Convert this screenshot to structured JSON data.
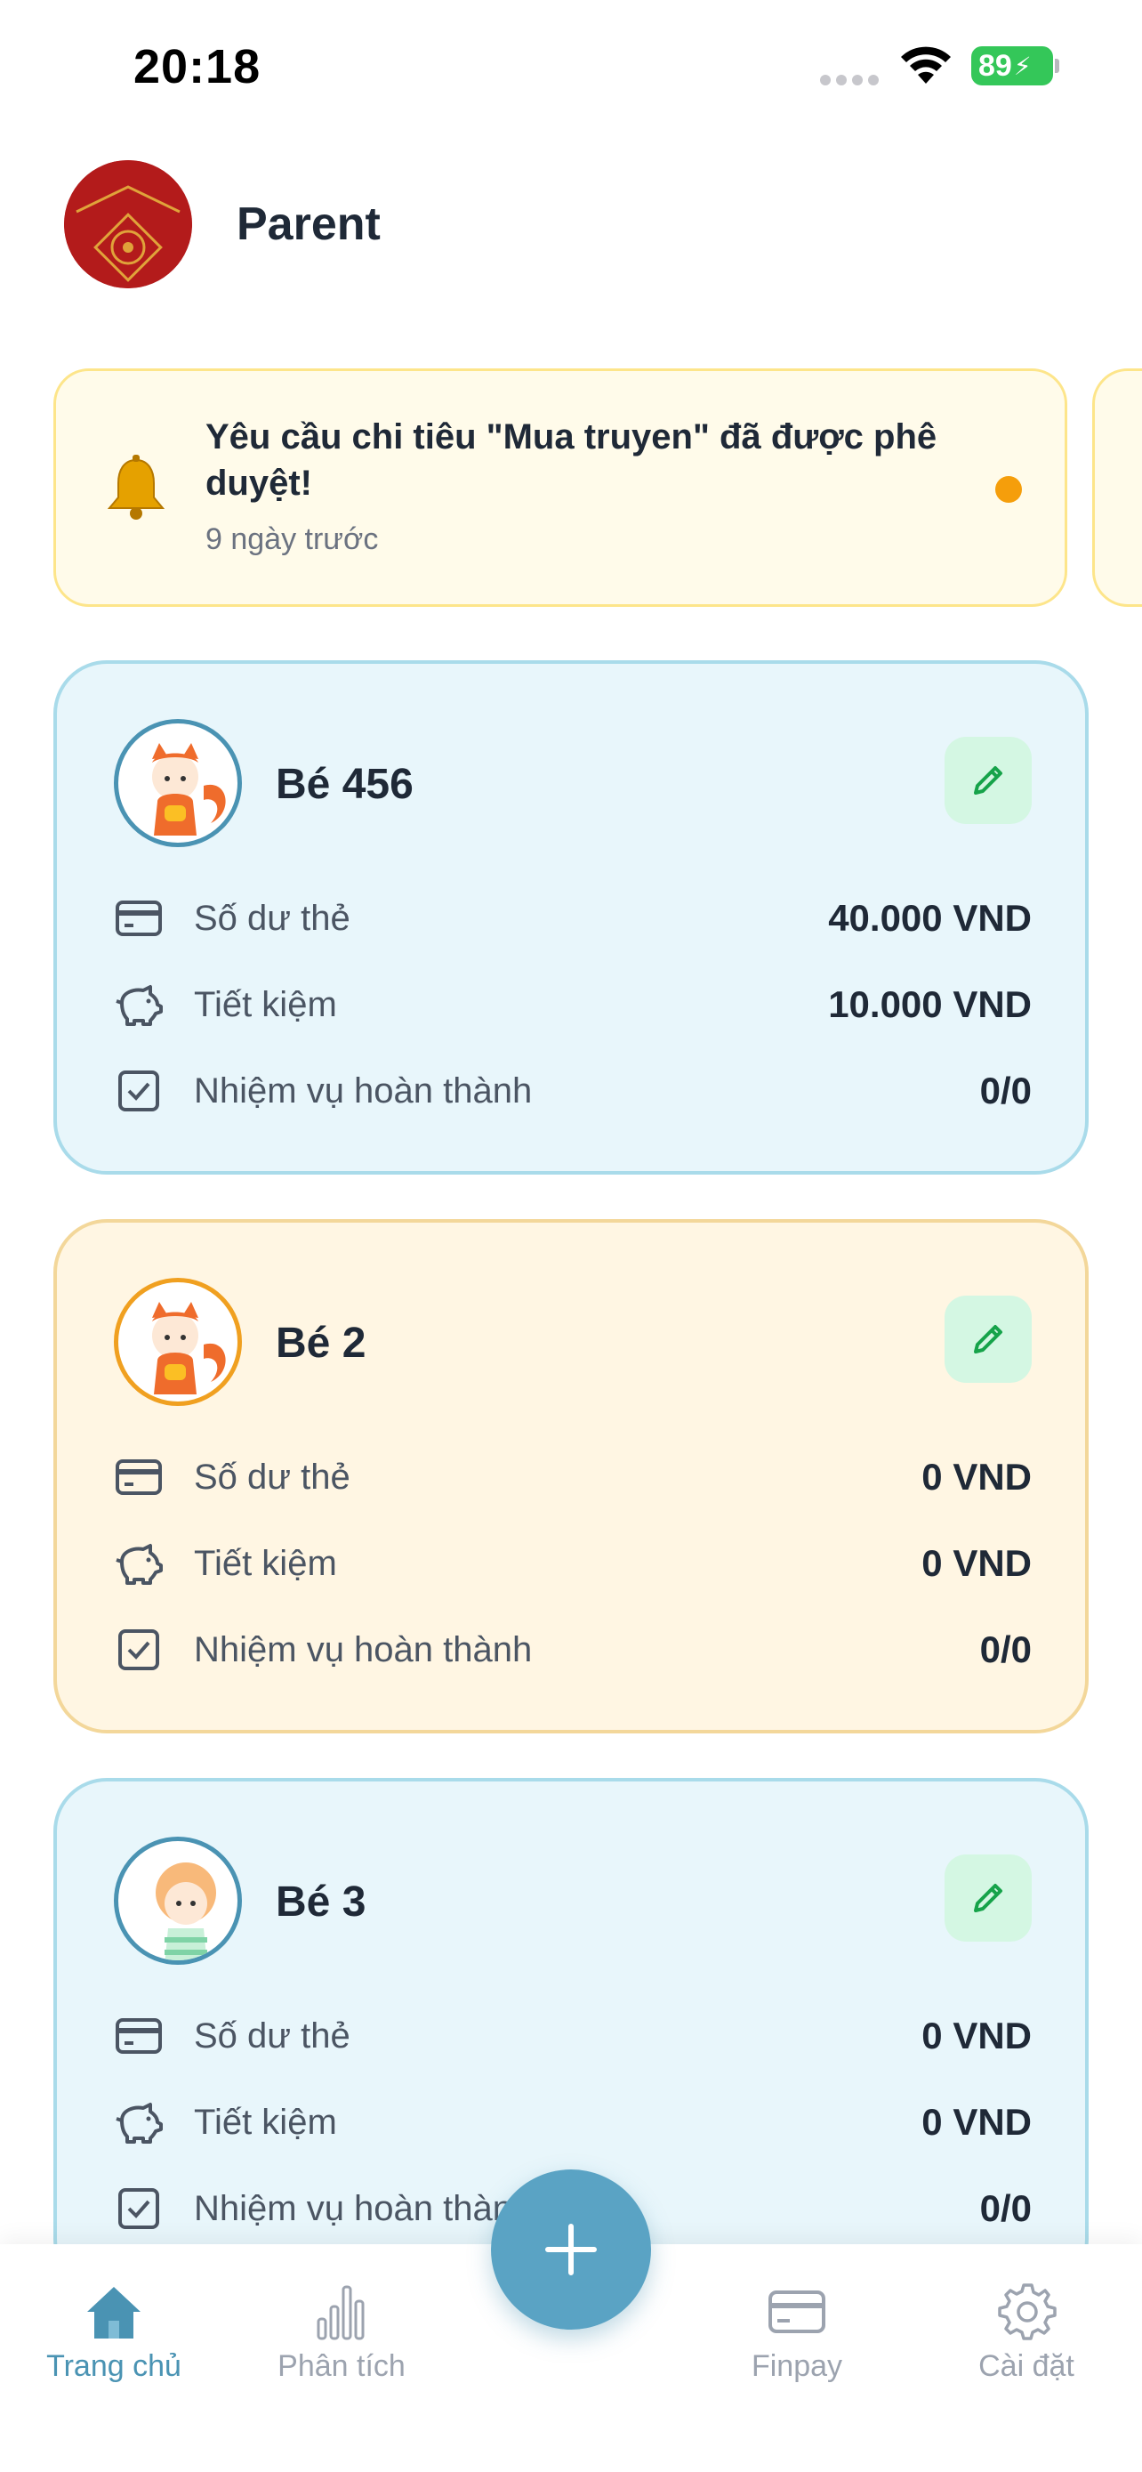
{
  "status_bar": {
    "time": "20:18",
    "battery": "89"
  },
  "profile": {
    "name": "Parent"
  },
  "notification": {
    "title": "Yêu cầu chi tiêu \"Mua truyen\" đã được phê duyệt!",
    "time": "9 ngày trước",
    "dot_color": "#f59e0b"
  },
  "labels": {
    "balance": "Số dư thẻ",
    "savings": "Tiết kiệm",
    "tasks": "Nhiệm vụ hoàn thành"
  },
  "children": [
    {
      "name": "Bé 456",
      "balance": "40.000 VND",
      "savings": "10.000 VND",
      "tasks": "0/0",
      "theme": "blue"
    },
    {
      "name": "Bé 2",
      "balance": "0 VND",
      "savings": "0 VND",
      "tasks": "0/0",
      "theme": "yellow"
    },
    {
      "name": "Bé 3",
      "balance": "0 VND",
      "savings": "0 VND",
      "tasks": "0/0",
      "theme": "blue"
    }
  ],
  "tabs": [
    {
      "label": "Trang chủ",
      "icon": "home-icon",
      "active": true
    },
    {
      "label": "Phân tích",
      "icon": "bar-chart-icon",
      "active": false
    },
    {
      "label": "Finpay",
      "icon": "card-icon",
      "active": false
    },
    {
      "label": "Cài đặt",
      "icon": "gear-icon",
      "active": false
    }
  ],
  "colors": {
    "accent": "#4a93b3",
    "fab": "#5aa3c4",
    "edit_bg": "#d4f7e3",
    "edit_icon": "#16a34a"
  }
}
